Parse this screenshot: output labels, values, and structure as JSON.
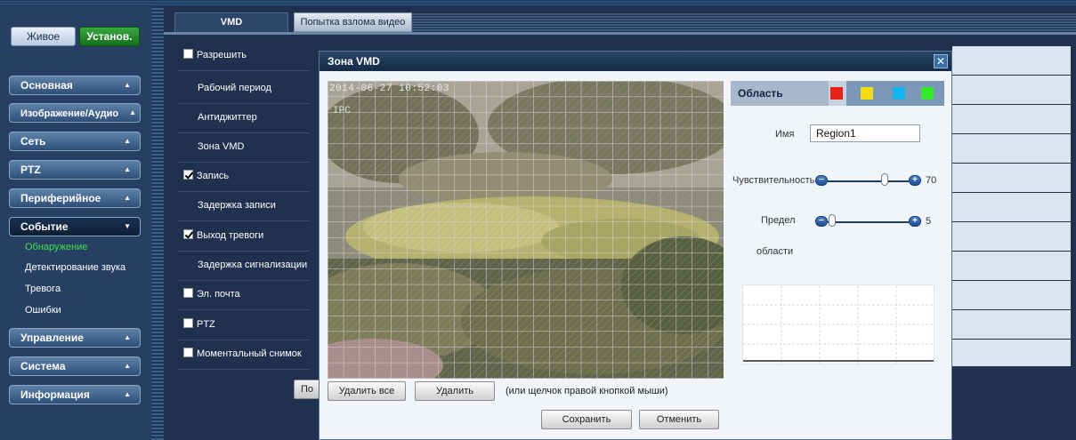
{
  "sidebar": {
    "live": "Живое",
    "setup": "Установ.",
    "menus": {
      "basic": "Основная",
      "imageaudio": "Изображение/Аудио",
      "network": "Сеть",
      "ptz": "PTZ",
      "peripheral": "Периферийное",
      "event": "Событие",
      "management": "Управление",
      "system": "Система",
      "info": "Информация"
    },
    "event_items": [
      "Обнаружение",
      "Детектирование звука",
      "Тревога",
      "Ошибки"
    ]
  },
  "tabs": {
    "vmd": "VMD",
    "tamper": "Попытка взлома видео"
  },
  "settings": {
    "enable": "Разрешить",
    "period": "Рабочий период",
    "antidither": "Антиджиттер",
    "zone": "Зона VMD",
    "record": "Запись",
    "record_delay": "Задержка записи",
    "alarm_out": "Выход тревоги",
    "alarm_delay": "Задержка сигнализации",
    "email": "Эл. почта",
    "ptz": "PTZ",
    "snapshot": "Моментальный снимок",
    "checked": {
      "enable": false,
      "record": true,
      "alarm_out": true,
      "email": false,
      "ptz": false,
      "snapshot": false
    }
  },
  "partial_button": "По",
  "modal": {
    "title": "Зона VMD",
    "video": {
      "timestamp": "2014-06-27 10:52:03",
      "osd": "IPC"
    },
    "delete_all": "Удалить все",
    "delete": "Удалить",
    "hint": "(или щелчок правой кнопкой мыши)",
    "save": "Сохранить",
    "cancel": "Отменить",
    "area": {
      "label": "Область",
      "colors": [
        "#e8221a",
        "#f3dc0f",
        "#12b5ee",
        "#35e82a"
      ]
    },
    "name_label": "Имя",
    "name_value": "Region1",
    "sensitivity_label": "Чувствительность",
    "sensitivity_value": "70",
    "sensitivity_fraction": 0.7,
    "threshold_label": "Предел",
    "threshold_sub": "области",
    "threshold_value": "5",
    "threshold_fraction": 0.05
  }
}
